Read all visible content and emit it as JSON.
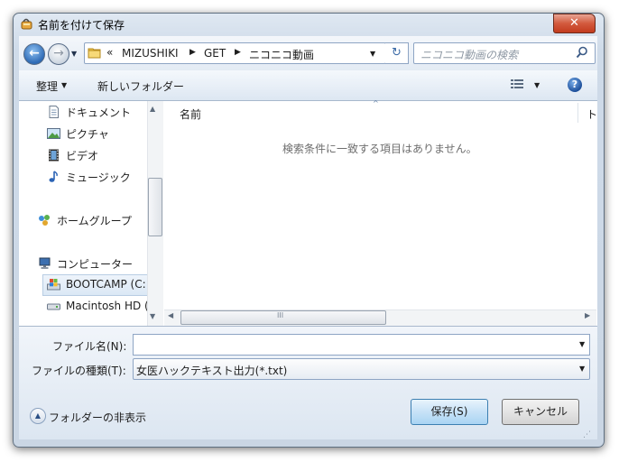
{
  "window": {
    "title": "名前を付けて保存",
    "close_glyph": "✕"
  },
  "nav": {
    "back_glyph": "←",
    "forward_glyph": "→",
    "dropdown_glyph": "▼",
    "breadcrumb_more": "«",
    "breadcrumbs": [
      "MIZUSHIKI",
      "GET",
      "ニコニコ動画"
    ],
    "separator": "▶",
    "refresh_glyph": "↻",
    "search_placeholder": "ニコニコ動画の検索"
  },
  "toolbar": {
    "organize_label": "整理",
    "dropdown_glyph": "▼",
    "new_folder_label": "新しいフォルダー",
    "help_glyph": "?"
  },
  "navpane": {
    "items": [
      {
        "label": "ドキュメント",
        "icon": "document-icon"
      },
      {
        "label": "ピクチャ",
        "icon": "picture-icon"
      },
      {
        "label": "ビデオ",
        "icon": "video-icon"
      },
      {
        "label": "ミュージック",
        "icon": "music-icon"
      },
      {
        "label": "ホームグループ",
        "icon": "homegroup-icon"
      },
      {
        "label": "コンピューター",
        "icon": "computer-icon"
      },
      {
        "label": "BOOTCAMP (C:",
        "icon": "drive-c-icon"
      },
      {
        "label": "Macintosh HD (",
        "icon": "drive-icon"
      }
    ]
  },
  "filelist": {
    "column_name": "名前",
    "column_next": "ト",
    "sort_glyph": "^",
    "empty_message": "検索条件に一致する項目はありません。",
    "scroll_glyph": "III"
  },
  "form": {
    "filename_label": "ファイル名(N):",
    "filename_value": "",
    "filetype_label": "ファイルの種類(T):",
    "filetype_value": "女医ハックテキスト出力(*.txt)",
    "dropdown_glyph": "▼",
    "hide_folders_glyph": "▲",
    "hide_folders_label": "フォルダーの非表示",
    "save_label": "保存(S)",
    "cancel_label": "キャンセル"
  },
  "colors": {
    "accent": "#3c7fb1",
    "frame": "#cad6e4"
  }
}
